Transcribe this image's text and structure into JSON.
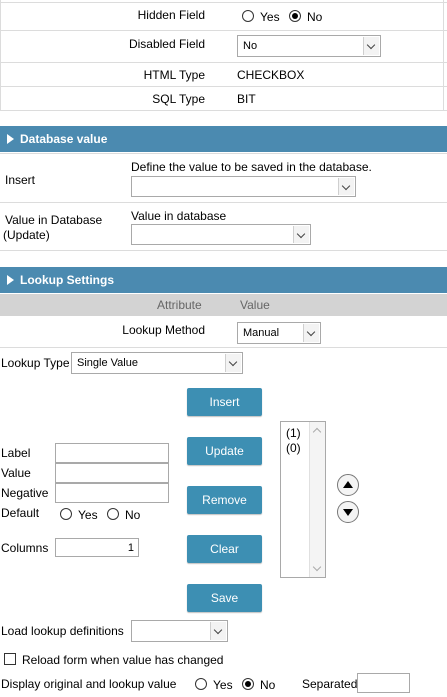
{
  "field_props": {
    "hidden_label": "Hidden Field",
    "hidden_yes": "Yes",
    "hidden_no": "No",
    "disabled_label": "Disabled Field",
    "disabled_value": "No",
    "html_type_label": "HTML Type",
    "html_type_value": "CHECKBOX",
    "sql_type_label": "SQL Type",
    "sql_type_value": "BIT"
  },
  "database": {
    "header": "Database value",
    "insert_label": "Insert",
    "insert_hint": "Define the value to be saved in the database.",
    "update_label_1": "Value in Database",
    "update_label_2": "(Update)",
    "update_hint": "Value in database"
  },
  "lookup": {
    "header": "Lookup Settings",
    "col_attribute": "Attribute",
    "col_value": "Value",
    "method_label": "Lookup Method",
    "method_value": "Manual",
    "type_label": "Lookup Type",
    "type_value": "Single Value",
    "label_label": "Label",
    "value_label": "Value",
    "negative_label": "Negative",
    "default_label": "Default",
    "default_yes": "Yes",
    "default_no": "No",
    "columns_label": "Columns",
    "columns_value": "1",
    "list_items": [
      "(1)",
      "(0)"
    ],
    "buttons": {
      "insert": "Insert",
      "update": "Update",
      "remove": "Remove",
      "clear": "Clear",
      "save": "Save"
    },
    "load_defs_label": "Load lookup definitions",
    "reload_label": "Reload form when value has changed",
    "display_label": "Display original and lookup value",
    "display_yes": "Yes",
    "display_no": "No",
    "separated_label": "Separated by"
  }
}
